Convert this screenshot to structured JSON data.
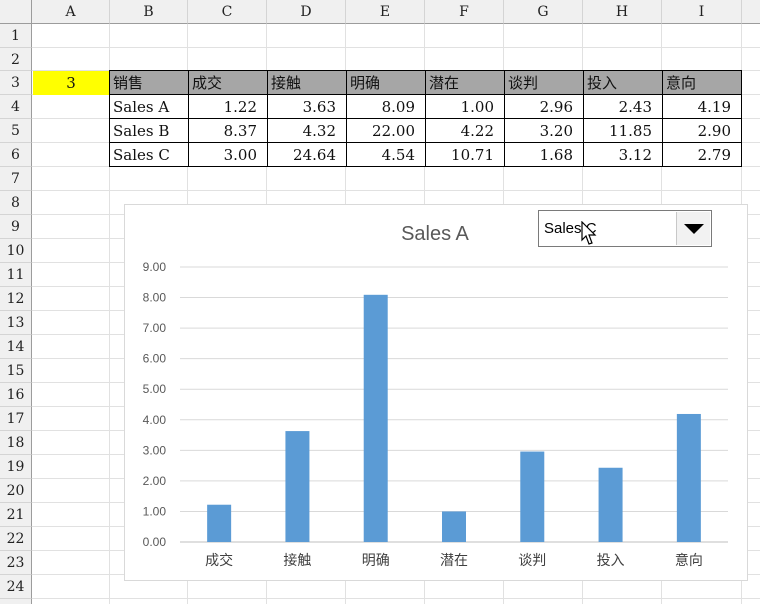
{
  "columns": [
    "A",
    "B",
    "C",
    "D",
    "E",
    "F",
    "G",
    "H",
    "I"
  ],
  "rows": [
    "1",
    "2",
    "3",
    "4",
    "5",
    "6",
    "7",
    "8",
    "9",
    "10",
    "11",
    "12",
    "13",
    "14",
    "15",
    "16",
    "17",
    "18",
    "19",
    "20",
    "21",
    "22",
    "23",
    "24"
  ],
  "cell_a3": "3",
  "table": {
    "header": [
      "销售",
      "成交",
      "接触",
      "明确",
      "潜在",
      "谈判",
      "投入",
      "意向"
    ],
    "rows": [
      [
        "Sales A",
        "1.22",
        "3.63",
        "8.09",
        "1.00",
        "2.96",
        "2.43",
        "4.19"
      ],
      [
        "Sales B",
        "8.37",
        "4.32",
        "22.00",
        "4.22",
        "3.20",
        "11.85",
        "2.90"
      ],
      [
        "Sales C",
        "3.00",
        "24.64",
        "4.54",
        "10.71",
        "1.68",
        "3.12",
        "2.79"
      ]
    ]
  },
  "dropdown": {
    "selected": "Sales C"
  },
  "colors": {
    "bar": "#5b9bd5",
    "highlight": "#ffff00",
    "header_fill": "#a6a6a6"
  },
  "chart_data": {
    "type": "bar",
    "title": "Sales A",
    "categories": [
      "成交",
      "接触",
      "明确",
      "潜在",
      "谈判",
      "投入",
      "意向"
    ],
    "values": [
      1.22,
      3.63,
      8.09,
      1.0,
      2.96,
      2.43,
      4.19
    ],
    "ylim": [
      0,
      9
    ],
    "yticks": [
      "0.00",
      "1.00",
      "2.00",
      "3.00",
      "4.00",
      "5.00",
      "6.00",
      "7.00",
      "8.00",
      "9.00"
    ],
    "grid": true,
    "legend": "none"
  }
}
